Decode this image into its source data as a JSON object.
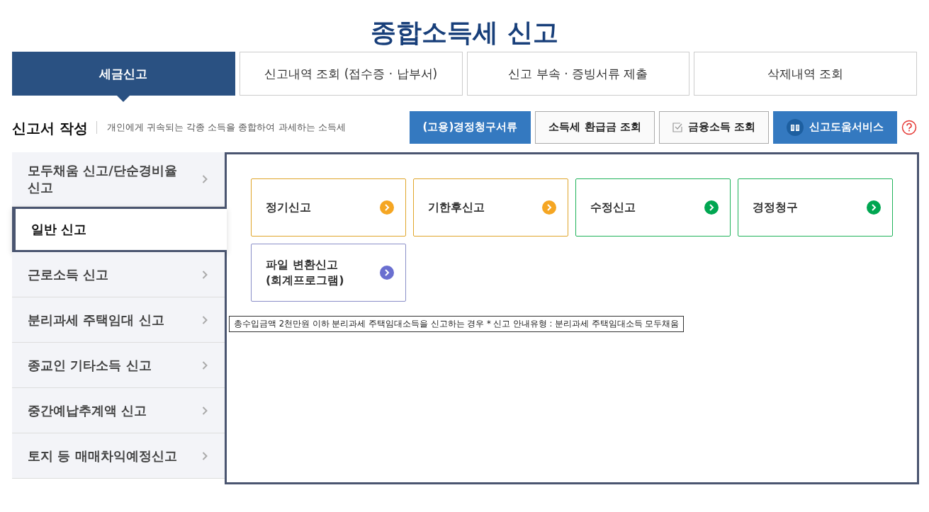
{
  "page_title": "종합소득세 신고",
  "tabs": [
    {
      "label": "세금신고",
      "selected": true
    },
    {
      "label": "신고내역 조회 (접수증 · 납부서)",
      "selected": false
    },
    {
      "label": "신고 부속 · 증빙서류 제출",
      "selected": false
    },
    {
      "label": "삭제내역 조회",
      "selected": false
    }
  ],
  "section": {
    "title": "신고서 작성",
    "description": "개인에게 귀속되는 각종 소득을 종합하여 과세하는 소득세"
  },
  "action_buttons": [
    {
      "label": "(고용)경정청구서류",
      "kind": "primary"
    },
    {
      "label": "소득세 환급금 조회",
      "kind": "plain"
    },
    {
      "label": "금융소득 조회",
      "kind": "check"
    },
    {
      "label": "신고도움서비스",
      "kind": "book"
    }
  ],
  "side_menu": [
    {
      "label": "모두채움 신고/단순경비율 신고",
      "selected": false
    },
    {
      "label": "일반 신고",
      "selected": true
    },
    {
      "label": "근로소득 신고",
      "selected": false
    },
    {
      "label": "분리과세 주택임대 신고",
      "selected": false
    },
    {
      "label": "종교인 기타소득 신고",
      "selected": false
    },
    {
      "label": "중간예납추계액 신고",
      "selected": false
    },
    {
      "label": "토지 등 매매차익예정신고",
      "selected": false
    }
  ],
  "cards": [
    {
      "label": "정기신고",
      "color": "#f5a623"
    },
    {
      "label": "기한후신고",
      "color": "#f5a623"
    },
    {
      "label": "수정신고",
      "color": "#00a651"
    },
    {
      "label": "경정청구",
      "color": "#00a651"
    },
    {
      "label": "파일 변환신고\n(회계프로그램)",
      "color": "#6a6fd0"
    }
  ],
  "tooltip": "총수입금액 2천만원 이하 분리과세 주택임대소득을 신고하는 경우 * 신고 안내유형 : 분리과세 주택임대소득 모두채움"
}
